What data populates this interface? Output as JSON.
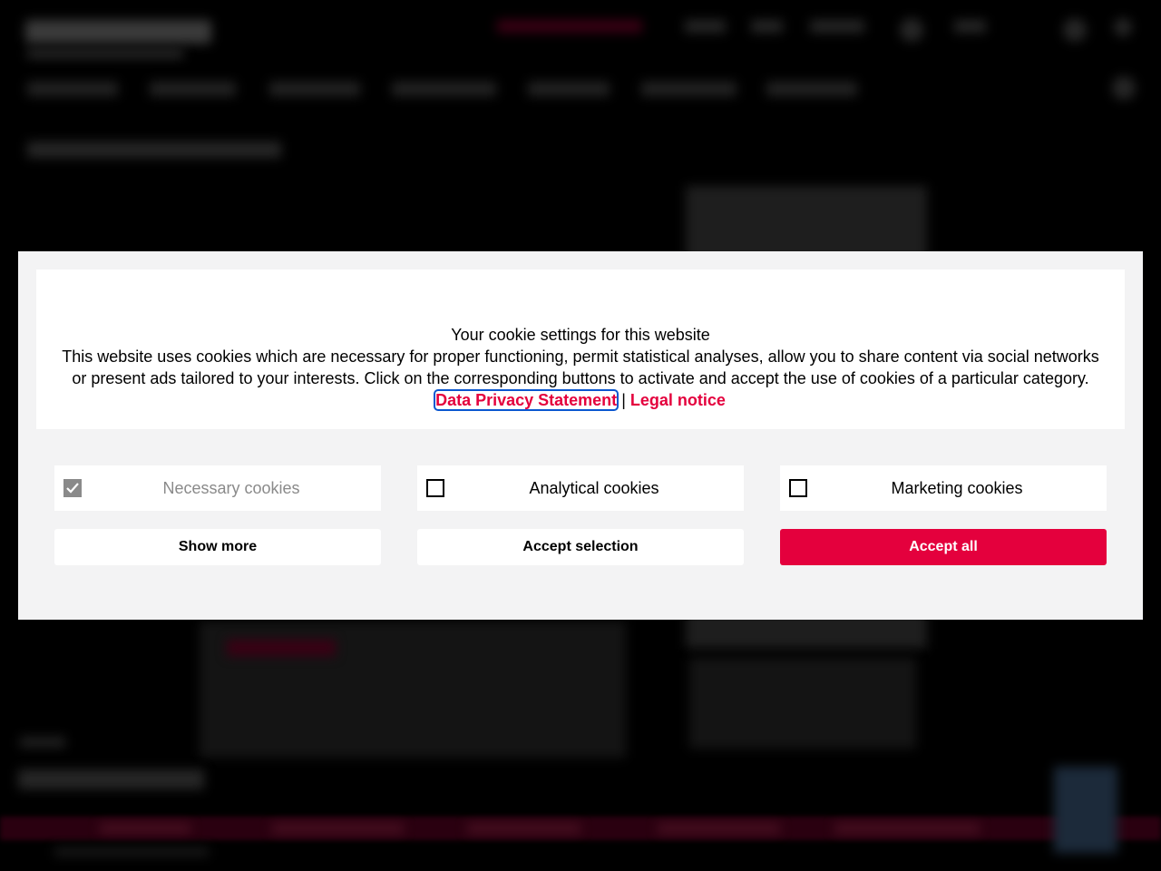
{
  "cookie_banner": {
    "title": "Your cookie settings for this website",
    "description": "This website uses cookies which are necessary for proper functioning, permit statistical analyses, allow you to share content via social networks or present ads tailored to your interests. Click on the corresponding buttons to activate and accept the use of cookies of a particular category.",
    "privacy_link": "Data Privacy Statement",
    "separator": "|",
    "legal_link": "Legal notice",
    "options": [
      {
        "label": "Necessary cookies",
        "checked": true,
        "disabled": true
      },
      {
        "label": "Analytical cookies",
        "checked": false,
        "disabled": false
      },
      {
        "label": "Marketing cookies",
        "checked": false,
        "disabled": false
      }
    ],
    "buttons": {
      "show_more": "Show more",
      "accept_selection": "Accept selection",
      "accept_all": "Accept all"
    }
  },
  "colors": {
    "accent": "#e4003d",
    "dialog_background": "#f3f3f4",
    "overlay": "#000000",
    "focus_ring": "#0b57d0",
    "disabled_checkbox": "#8a8a8a"
  }
}
